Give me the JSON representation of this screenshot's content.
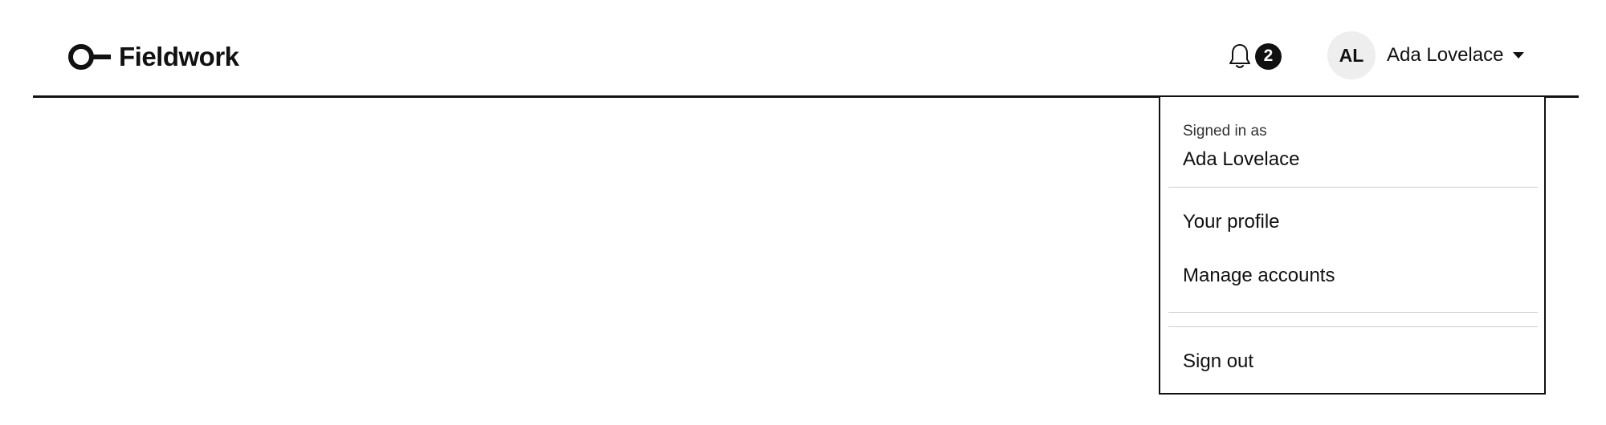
{
  "brand": {
    "name": "Fieldwork",
    "logo_icon": "ring-key-logo-icon"
  },
  "header": {
    "notifications": {
      "icon": "bell-icon",
      "count": "2"
    },
    "user": {
      "initials": "AL",
      "name": "Ada Lovelace",
      "caret_icon": "caret-down-icon"
    }
  },
  "user_menu": {
    "signed_in_label": "Signed in as",
    "signed_in_user": "Ada Lovelace",
    "items": [
      {
        "label": "Your profile"
      },
      {
        "label": "Manage accounts"
      }
    ],
    "sign_out_label": "Sign out"
  },
  "colors": {
    "ink": "#111111",
    "avatar_bg": "#eeeeee",
    "divider": "#cfcfcf",
    "background": "#ffffff"
  }
}
